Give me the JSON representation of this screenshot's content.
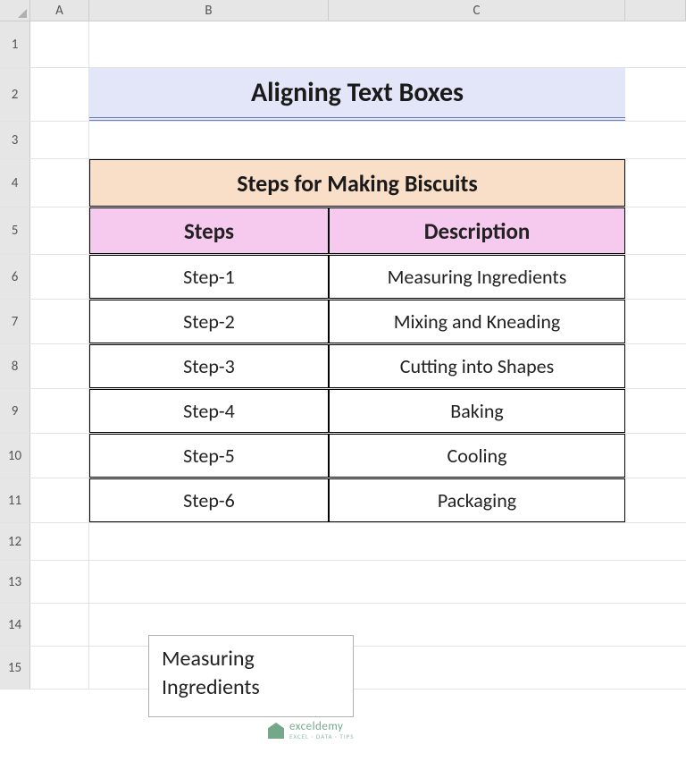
{
  "columns": {
    "A": "A",
    "B": "B",
    "C": "C"
  },
  "rows": [
    "1",
    "2",
    "3",
    "4",
    "5",
    "6",
    "7",
    "8",
    "9",
    "10",
    "11",
    "12",
    "13",
    "14",
    "15"
  ],
  "title": "Aligning Text Boxes",
  "table": {
    "title": "Steps for Making Biscuits",
    "headers": {
      "steps": "Steps",
      "description": "Description"
    },
    "data": [
      {
        "step": "Step-1",
        "desc": "Measuring Ingredients"
      },
      {
        "step": "Step-2",
        "desc": "Mixing and Kneading"
      },
      {
        "step": "Step-3",
        "desc": "Cutting into Shapes"
      },
      {
        "step": "Step-4",
        "desc": "Baking"
      },
      {
        "step": "Step-5",
        "desc": "Cooling"
      },
      {
        "step": "Step-6",
        "desc": "Packaging"
      }
    ]
  },
  "textbox": {
    "content": "Measuring Ingredients"
  },
  "watermark": {
    "brand": "exceldemy",
    "tagline": "EXCEL · DATA · TIPS"
  }
}
